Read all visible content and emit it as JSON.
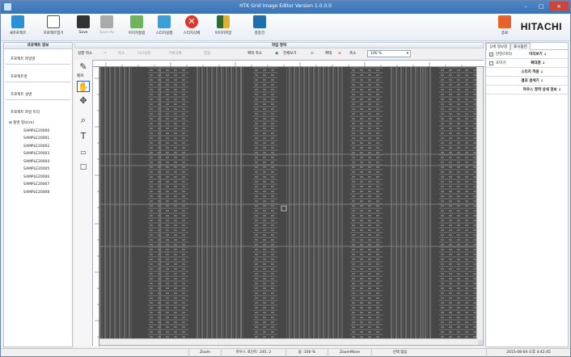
{
  "window": {
    "title": "HTK Grid Image Editor Version 1.0.0.0",
    "min": "–",
    "max": "□",
    "close": "×"
  },
  "ribbon": {
    "new_project": "새프로젝트",
    "open_project": "프로젝트열기",
    "save": "Save",
    "save_as": "Save As",
    "image_match": "이미지정합",
    "stitch_run": "스티치실행",
    "stitch_delete": "스티치삭제",
    "image_save": "이미지저장",
    "layout": "창종건",
    "exit": "종료",
    "brand": "HITACHI"
  },
  "left_panel": {
    "header": "프로젝트 정보",
    "project_file": "프로젝트 파일명",
    "project_name": "프로젝트명",
    "project_desc": "프로젝트 설명",
    "tree_title": "프로젝트 파일 트리",
    "tree_root": "촬영 정보(m)",
    "tree_items": [
      "SAMPLE20000",
      "SAMPLE20001",
      "SAMPLE20002",
      "SAMPLE20003",
      "SAMPLE20004",
      "SAMPLE20005",
      "SAMPLE20006",
      "SAMPLE20007",
      "SAMPLE20008"
    ]
  },
  "work": {
    "header": "작업 영역",
    "undo": "실행 취소",
    "cancel": "취소",
    "ctrl_setting": "Ctrl설정",
    "record_delete": "기록삭제",
    "unknown": "창움",
    "zoom_in": "확대 축소",
    "fit_all": "전체보기",
    "zoom_plus": "확대",
    "zoom_minus": "축소",
    "zoom_value": "100 %",
    "pen_label": "펼쳐",
    "tools_alt": "브러쉬"
  },
  "right_panel": {
    "tab_detail": "상세 정보창",
    "tab_display": "표시옵션",
    "preview_label": "반전(미리)",
    "preview_btn": "미리보기 ↓",
    "zoom_label": "초미기",
    "zoom_btn": "확대경 ↓",
    "stitch_apply": "스티치 적용 ↓",
    "result_check": "결과 검색기 ↓",
    "mouse_detail": "마우스 영역 상세 정보 ↓"
  },
  "status": {
    "mode": "Zoom",
    "mouse_pos": "마우스 포인트: 245, 2",
    "zoom": "줌 :100 %",
    "zoom_move": "ZoomMove",
    "selection": "선택 없음",
    "datetime": "2015-08-04 오후 4:42:45"
  },
  "colors": {
    "titlebar": "#3b73b5",
    "image": "#4a4a4a",
    "active_tool": "#2b59c3"
  }
}
